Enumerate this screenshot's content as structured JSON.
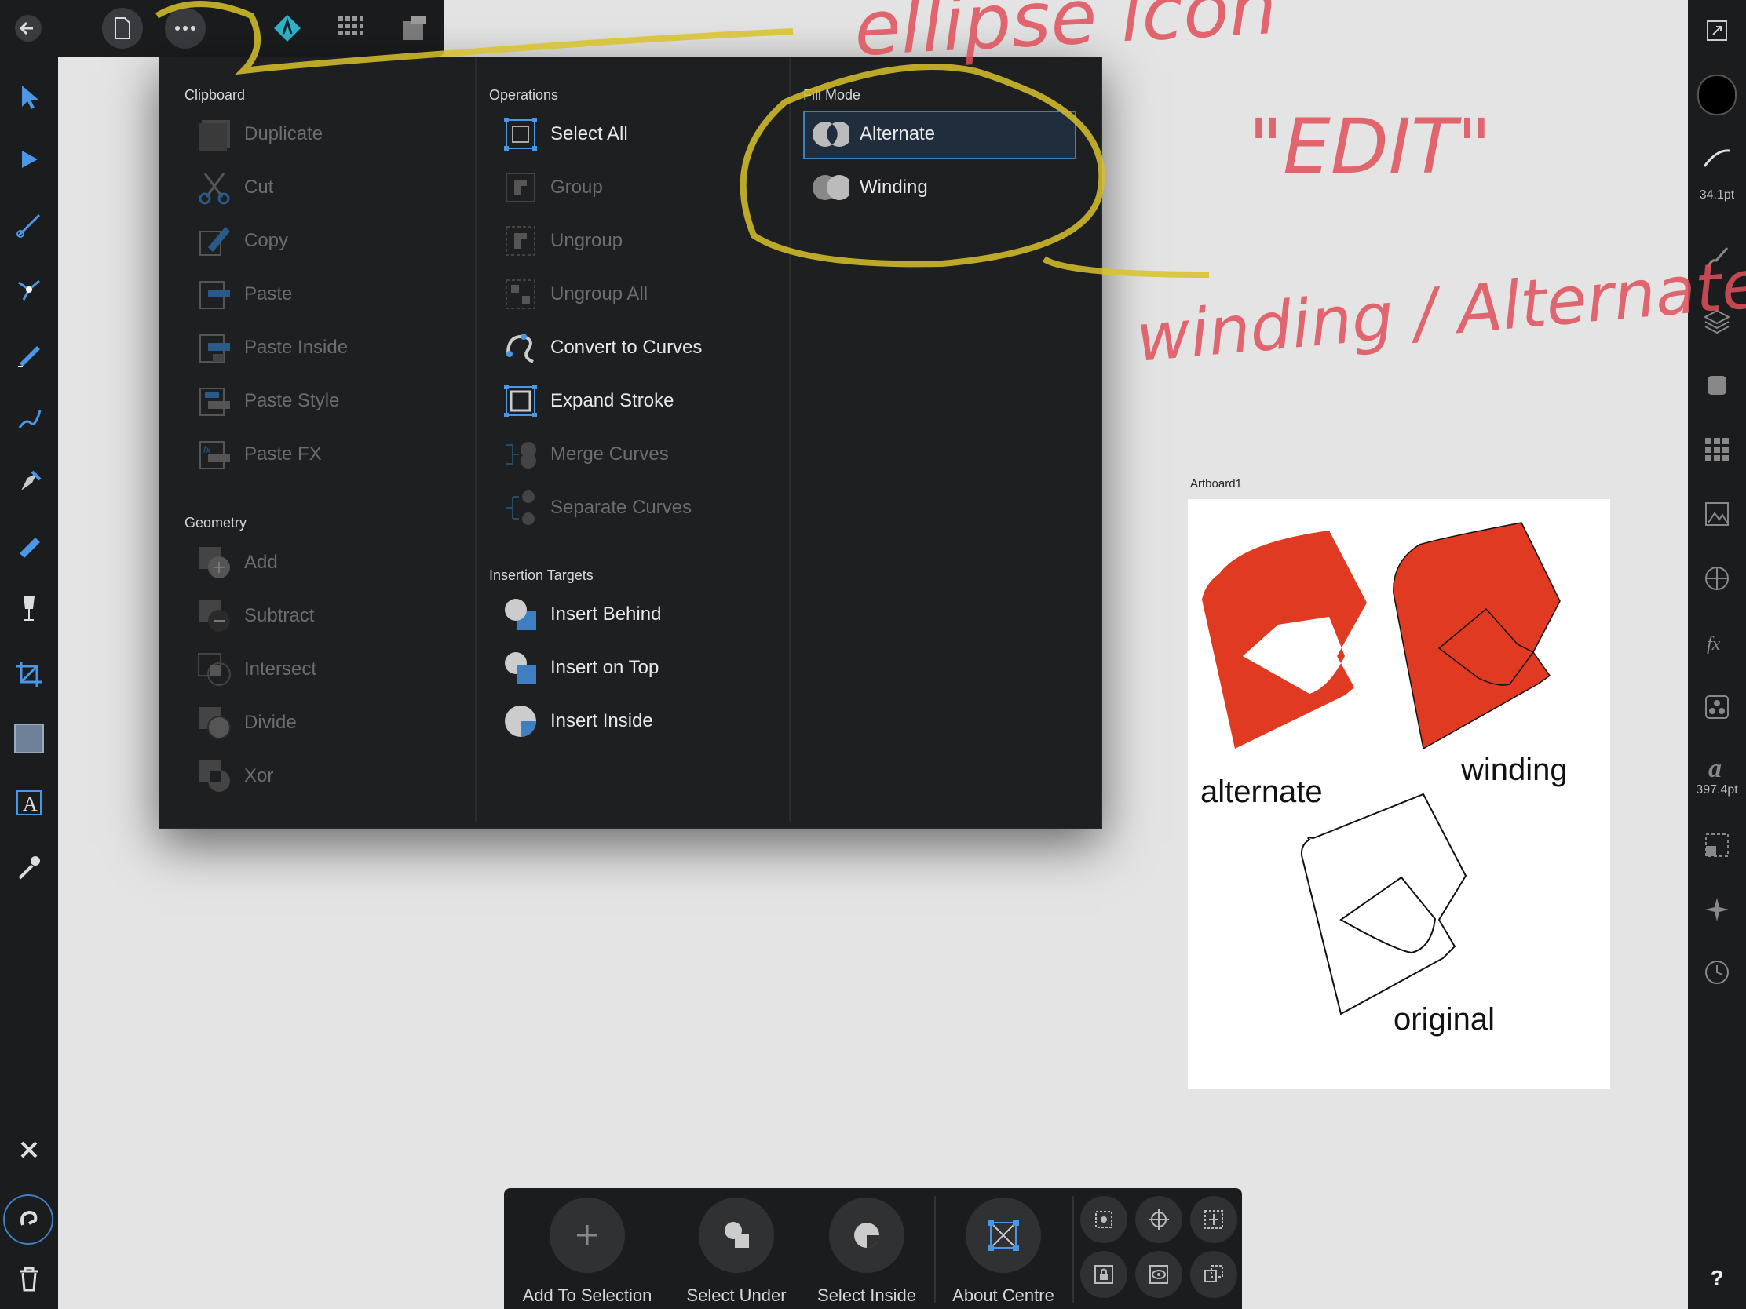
{
  "menu": {
    "clipboard": {
      "title": "Clipboard",
      "items": [
        "Duplicate",
        "Cut",
        "Copy",
        "Paste",
        "Paste Inside",
        "Paste Style",
        "Paste FX"
      ]
    },
    "geometry": {
      "title": "Geometry",
      "items": [
        "Add",
        "Subtract",
        "Intersect",
        "Divide",
        "Xor"
      ]
    },
    "operations": {
      "title": "Operations",
      "items": [
        "Select All",
        "Group",
        "Ungroup",
        "Ungroup All",
        "Convert to Curves",
        "Expand Stroke",
        "Merge Curves",
        "Separate Curves"
      ]
    },
    "insertion": {
      "title": "Insertion Targets",
      "items": [
        "Insert Behind",
        "Insert on Top",
        "Insert Inside"
      ]
    },
    "fill_mode": {
      "title": "Fill Mode",
      "items": [
        "Alternate",
        "Winding"
      ],
      "selected": "Alternate"
    }
  },
  "artboard": {
    "name": "Artboard1",
    "labels": {
      "alternate": "alternate",
      "winding": "winding",
      "original": "original"
    },
    "shape_color": "#e03a22"
  },
  "right_panel": {
    "brush_width": "34.1pt",
    "font_size": "397.4pt",
    "help": "?"
  },
  "bottom_bar": {
    "buttons": [
      "Add To Selection",
      "Select Under",
      "Select Inside",
      "About Centre"
    ]
  },
  "annotations": {
    "ellipse_icon": "ellipse icon",
    "edit": "\"EDIT\"",
    "winding_alternate": "winding / Alternate"
  },
  "colors": {
    "accent": "#3f7fc1",
    "highlight_yellow": "#d9c22a",
    "annotation_red": "#e0505a"
  }
}
